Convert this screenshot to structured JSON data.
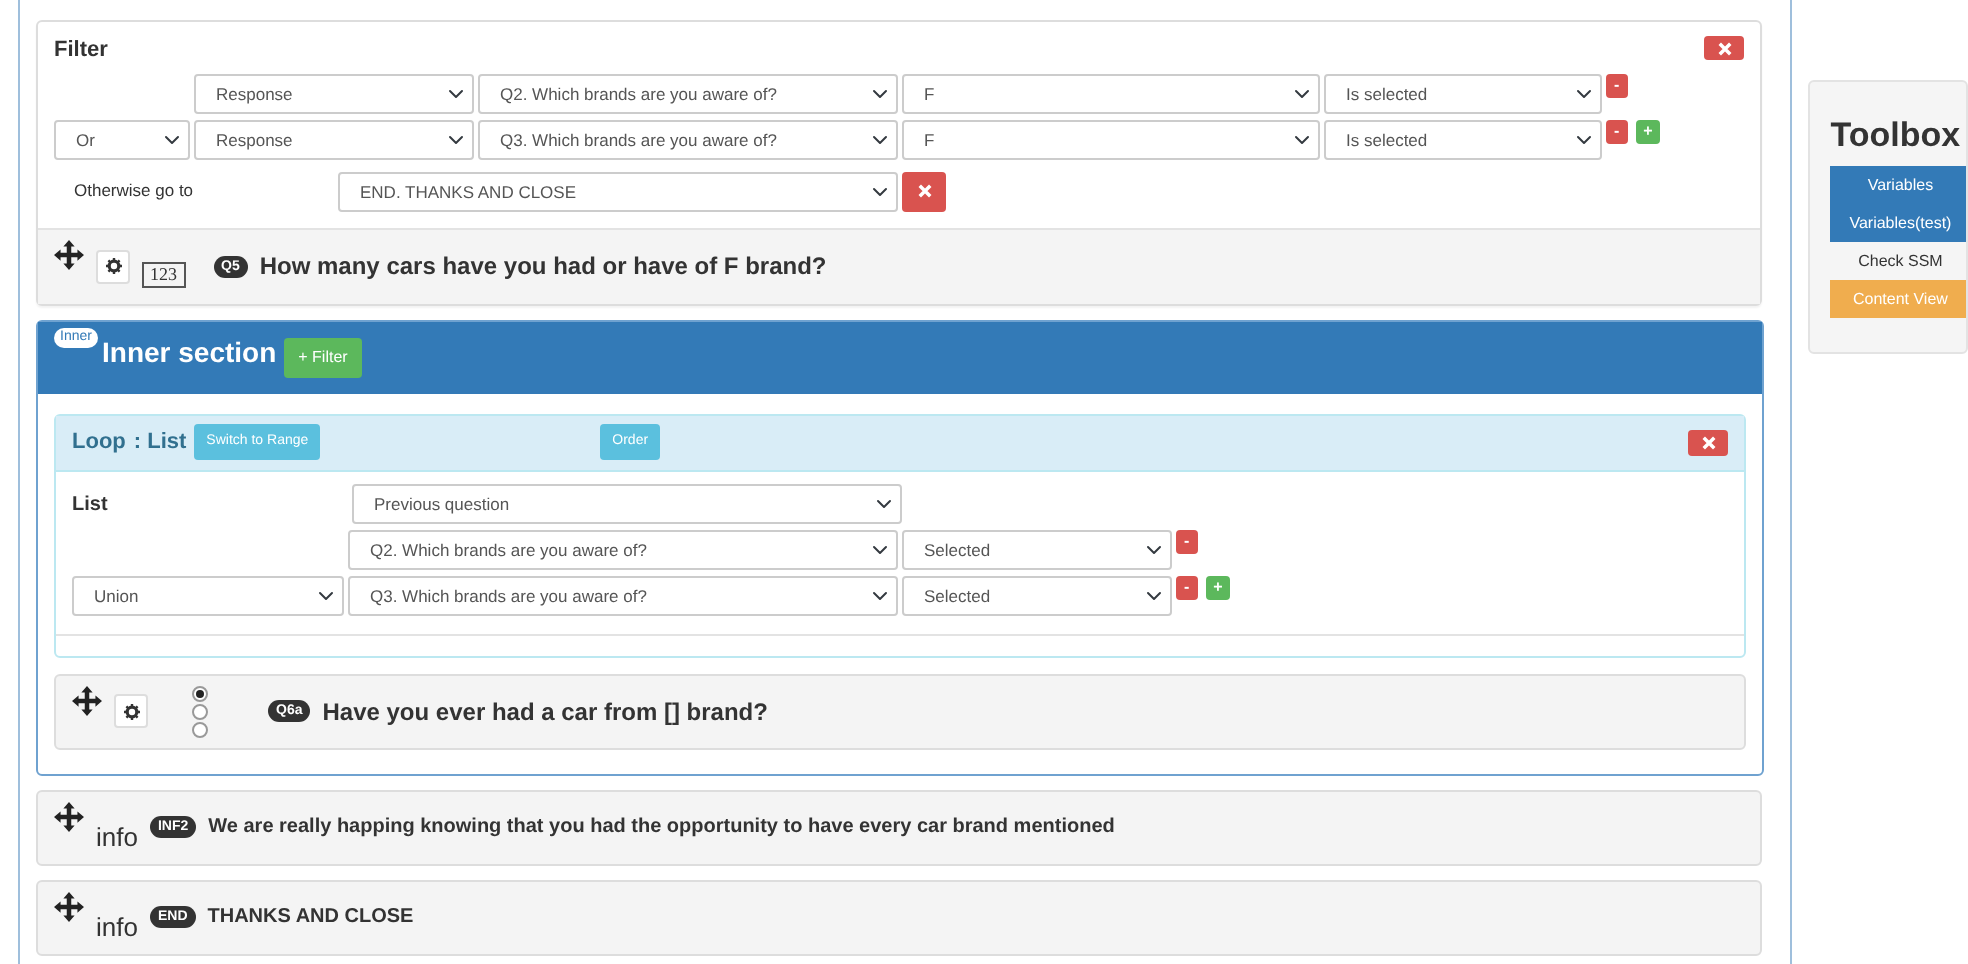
{
  "filter": {
    "title": "Filter",
    "rows": [
      {
        "connector": null,
        "source": "Response",
        "question": "Q2. Which brands are you aware of?",
        "value": "F",
        "condition": "Is selected",
        "buttons": [
          {
            "kind": "remove",
            "label": "-"
          }
        ]
      },
      {
        "connector": "Or",
        "source": "Response",
        "question": "Q3. Which brands are you aware of?",
        "value": "F",
        "condition": "Is selected",
        "buttons": [
          {
            "kind": "remove",
            "label": "-"
          },
          {
            "kind": "add",
            "label": "+"
          }
        ]
      }
    ],
    "otherwise_label": "Otherwise go to",
    "otherwise_value": "END. THANKS AND CLOSE"
  },
  "question_q5": {
    "type_label": "123",
    "code": "Q5",
    "text": "How many cars have you had or have of F brand?"
  },
  "inner_section": {
    "tag": "Inner",
    "title": "Inner section",
    "filter_button": "+ Filter",
    "loop": {
      "title": "Loop",
      "type": ": List",
      "switch_button": "Switch to Range",
      "order_button": "Order",
      "list_label": "List",
      "source": "Previous question",
      "rows": [
        {
          "connector": null,
          "question": "Q2. Which brands are you aware of?",
          "condition": "Selected",
          "buttons": [
            {
              "kind": "remove",
              "label": "-"
            }
          ]
        },
        {
          "connector": "Union",
          "question": "Q3. Which brands are you aware of?",
          "condition": "Selected",
          "buttons": [
            {
              "kind": "remove",
              "label": "-"
            },
            {
              "kind": "add",
              "label": "+"
            }
          ]
        }
      ]
    },
    "question": {
      "code": "Q6a",
      "text": "Have you ever had a car from [] brand?",
      "options": [
        {
          "selected": true
        },
        {
          "selected": false
        },
        {
          "selected": false
        }
      ]
    }
  },
  "info_items": [
    {
      "type": "info",
      "code": "INF2",
      "text": "We are really happing knowing that you had the opportunity to have every car brand mentioned"
    },
    {
      "type": "info",
      "code": "END",
      "text": "THANKS AND CLOSE"
    }
  ],
  "toolbox": {
    "title": "Toolbox",
    "items": [
      {
        "label": "Variables",
        "kind": "primary"
      },
      {
        "label": "Variables(test)",
        "kind": "primary"
      },
      {
        "label": "Check SSM",
        "kind": "plain"
      },
      {
        "label": "Content View",
        "kind": "warning"
      }
    ]
  }
}
